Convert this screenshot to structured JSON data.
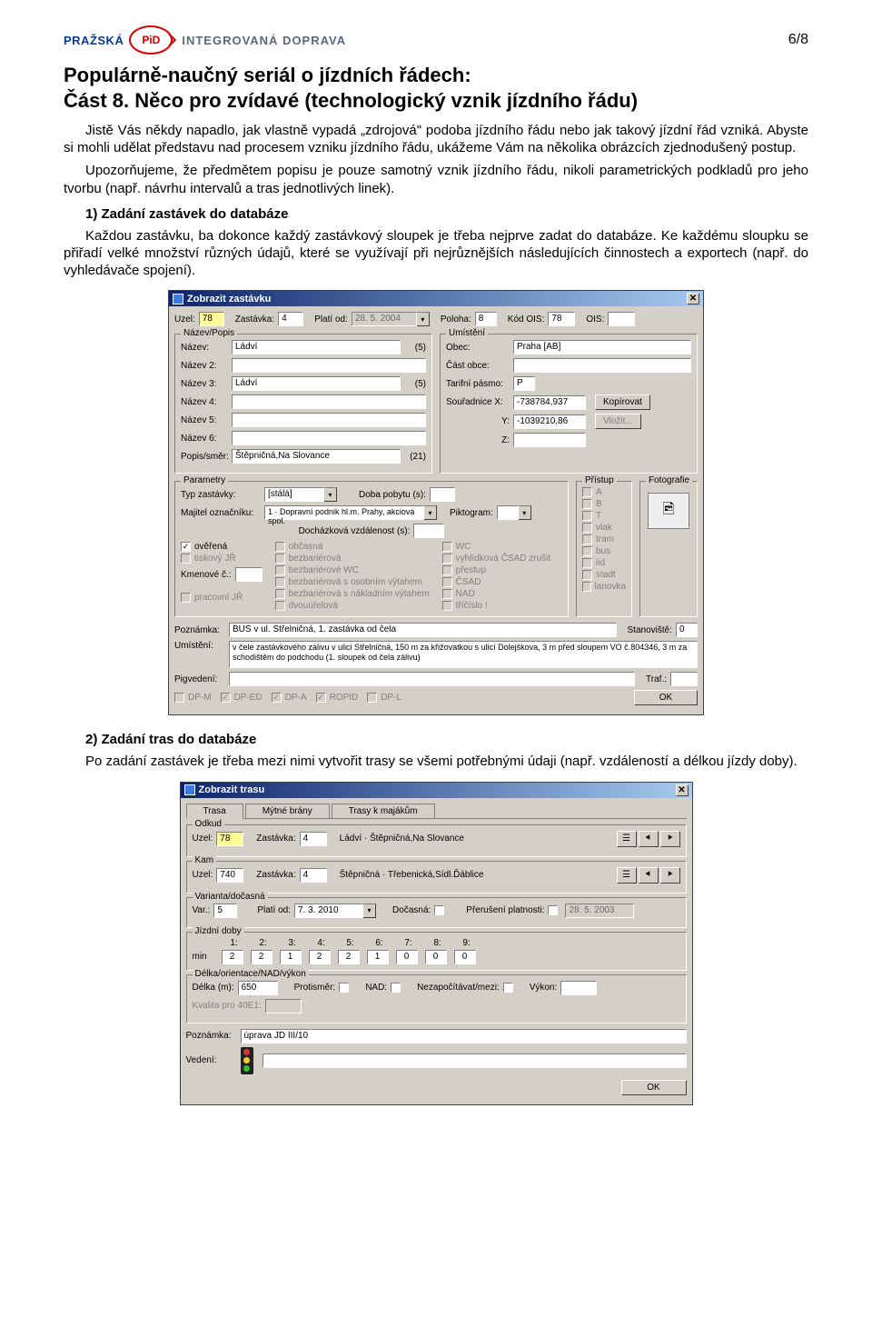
{
  "page_number": "6/8",
  "logo": {
    "left": "PRAŽSKÁ",
    "badge": "PiD",
    "right": "INTEGROVANÁ DOPRAVA"
  },
  "title": "Populárně-naučný seriál o jízdních řádech:",
  "subtitle": "Část 8. Něco pro zvídavé (technologický vznik jízdního řádu)",
  "para1": "Jistě Vás někdy napadlo, jak vlastně vypadá „zdrojová\" podoba jízdního řádu nebo jak takový jízdní řád vzniká. Abyste si mohli udělat představu nad procesem vzniku jízdního řádu, ukážeme Vám na několika obrázcích zjednodušený postup.",
  "para2": "Upozorňujeme, že předmětem popisu je pouze samotný vznik jízdního řádu, nikoli parametrických podkladů pro jeho tvorbu (např. návrhu intervalů a tras jednotlivých linek).",
  "sec1_heading": "1) Zadání zastávek do databáze",
  "sec1_para": "Každou zastávku, ba dokonce každý zastávkový sloupek je třeba nejprve zadat do databáze. Ke každému sloupku se přiřadí velké množství různých údajů, které se využívají při nejrůznějších následujících činnostech a exportech (např. do vyhledávače spojení).",
  "dlg1": {
    "title": "Zobrazit zastávku",
    "uzel_label": "Uzel:",
    "uzel": "78",
    "zast_label": "Zastávka:",
    "zast": "4",
    "platiod_label": "Platí od:",
    "platiod": "28. 5. 2004",
    "poloha_label": "Poloha:",
    "poloha": "8",
    "kodois_label": "Kód OIS:",
    "kodois": "78",
    "ois_label": "OIS:",
    "ois": "",
    "group_nazev": "Název/Popis",
    "nazev_label": "Název:",
    "nazev": "Ládví",
    "nazev_paren": "(5)",
    "nazev2_label": "Název 2:",
    "nazev3_label": "Název 3:",
    "nazev3": "Ládví",
    "nazev3_paren": "(5)",
    "nazev4_label": "Název 4:",
    "nazev5_label": "Název 5:",
    "nazev6_label": "Název 6:",
    "popis_label": "Popis/směr:",
    "popis": "Štěpničná,Na Slovance",
    "popis_paren": "(21)",
    "group_umisteni": "Umístění",
    "obec_label": "Obec:",
    "obec": "Praha [AB]",
    "castobce_label": "Část obce:",
    "pasmo_label": "Tarifní pásmo:",
    "pasmo": "P",
    "sourx_label": "Souřadnice  X:",
    "sourx": "-738784,937",
    "soury_label": "Y:",
    "soury": "-1039210,86",
    "sourz_label": "Z:",
    "kopirovat": "Kopírovat",
    "vlozit": "Vložit...",
    "group_param": "Parametry",
    "typ_label": "Typ zastávky:",
    "typ": "[stálá]",
    "majitel_label": "Majitel označníku:",
    "majitel": "1 · Dopravní podnik hl.m. Prahy, akciová spol.",
    "doba_label": "Doba pobytu (s):",
    "pikto_label": "Piktogram:",
    "dochaz_label": "Docházková vzdálenost (s):",
    "group_pristup": "Přístup",
    "group_foto": "Fotografie",
    "cb_overena": "ověřená",
    "cb_tisk": "tiskový JŘ",
    "cb_prac": "pracovní JŘ",
    "kmen_label": "Kmenové č.:",
    "col2": [
      "občasná",
      "bezbariérová",
      "bezbariérové WC",
      "bezbariérová s osobním výtahem",
      "bezbariérová s nákladním výtahem",
      "dvouúřelová"
    ],
    "col3": [
      "WC",
      "vyhlídková ČSAD zrušit",
      "přestup",
      "ČSAD",
      "NAD",
      "tříčíslo !"
    ],
    "pristup_items": [
      "A",
      "B",
      "T",
      "vlak",
      "tram",
      "bus",
      "iid",
      "stadt",
      "lanovka"
    ],
    "pozn_label": "Poznámka:",
    "pozn": "BUS v ul. Střelničná, 1. zastávka od čela",
    "stanov_label": "Stanoviště:",
    "stanov": "0",
    "umist_label": "Umístění:",
    "umist": "v čele zastávkového zálivu v ulici Střelničná, 150 m za křižovatkou s ulicí Dolejškova, 3 m před sloupem VO č.804346, 3 m za schodištěm do podchodu (1. sloupek od čela zálivu)",
    "pigv_label": "Pigvedení:",
    "traf_label": "Traf.:",
    "bottom_cbs": [
      "DP-M",
      "DP-ED",
      "DP-A",
      "ROPID",
      "DP-L"
    ],
    "ok": "OK"
  },
  "sec2_heading": "2) Zadání tras do databáze",
  "sec2_para": "Po zadání zastávek je třeba mezi nimi vytvořit trasy se všemi potřebnými údaji (např. vzdáleností a délkou jízdy doby).",
  "dlg2": {
    "title": "Zobrazit trasu",
    "tab1": "Trasa",
    "tab2": "Mýtné brány",
    "tab3": "Trasy k majákům",
    "group_odkud": "Odkud",
    "group_kam": "Kam",
    "uzel_label": "Uzel:",
    "zast_label": "Zastávka:",
    "odkud_uzel": "78",
    "odkud_zast": "4",
    "odkud_text": "Ládví · Štěpničná,Na Slovance",
    "kam_uzel": "740",
    "kam_zast": "4",
    "kam_text": "Štěpničná · Třebenická,Sídl.Ďáblice",
    "group_var": "Varianta/dočasná",
    "var_label": "Var.:",
    "var": "5",
    "platiod_label": "Platí od:",
    "platiod": "7. 3. 2010",
    "docasna_label": "Dočasná:",
    "preruseni_label": "Přerušení platnosti:",
    "preruseni": "28. 5. 2003",
    "group_jd": "Jízdní doby",
    "jd_headers": [
      "1:",
      "2:",
      "3:",
      "4:",
      "5:",
      "6:",
      "7:",
      "8:",
      "9:"
    ],
    "jd_min_label": "min",
    "jd_values": [
      "2",
      "2",
      "1",
      "2",
      "2",
      "1",
      "0",
      "0",
      "0"
    ],
    "group_delka": "Délka/orientace/NAD/výkon",
    "delka_label": "Délka (m):",
    "delka": "650",
    "protismer_label": "Protisměr:",
    "nad_label": "NAD:",
    "nezap_label": "Nezapočítávat/mezi:",
    "vykon_label": "Výkon:",
    "kval_label": "Kvalita pro 40E1:",
    "pozn_label": "Poznámka:",
    "pozn": "úprava JD III/10",
    "vedeni_label": "Vedení:",
    "ok": "OK"
  }
}
